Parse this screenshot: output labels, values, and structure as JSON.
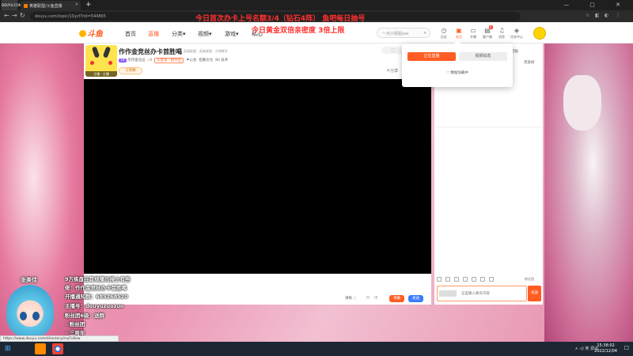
{
  "browser": {
    "corner_logo": "DOUYU.COM",
    "tab_title": "英雄联盟/斗鱼直播",
    "new_tab": "+",
    "url": "douyu.com/topic/10ycf?rid=544865",
    "window_controls": "— ▢ ✕"
  },
  "overlay_headlines": {
    "line1": "今日首次办卡上号名额3/4（钻石4阵）    鱼吧每日抽号",
    "line2": "今日黄金双倍亲密度  3倍上限"
  },
  "site_header": {
    "brand": "斗鱼",
    "nav": [
      "首页",
      "直播",
      "分类",
      "视频",
      "游戏",
      "私心"
    ],
    "search_placeholder": "一点小姐姐sex",
    "icons": [
      {
        "icon": "history-icon",
        "label": "历史"
      },
      {
        "icon": "follow-icon",
        "label": "关注"
      },
      {
        "icon": "broadcast-icon",
        "label": "开播"
      },
      {
        "icon": "client-icon",
        "label": "客户端"
      },
      {
        "icon": "bell-icon",
        "label": "消息"
      },
      {
        "icon": "task-icon",
        "label": "任务中心"
      }
    ],
    "client_badge": "6"
  },
  "room": {
    "anchor_level_bar": "主播 · 主播",
    "title": "作作金竞丝办卡首胜喝",
    "category": "英雄联盟 · 英雄联盟 · 大神教学",
    "tag": "14",
    "anchor_name": "作作金竞丝",
    "heat": "0",
    "rank": "斗鱼第一搞笑区",
    "fans_label": "公会",
    "region": "招募文化",
    "extra": "80 技术",
    "follow_chip": "订阅数",
    "share": "分享",
    "loading_glyph": "◌"
  },
  "player_bar": {
    "quality": "清晰",
    "settings": "◷",
    "full": "◫",
    "btn_orange": "弹幕",
    "btn_blue": "发送"
  },
  "right_panel": {
    "rank_top": "回报",
    "rank_sub": "贵族榜",
    "fan_club": "粉丝团",
    "chat_placeholder": "这里输入聊天内容",
    "send": "发送"
  },
  "follow_dropdown": {
    "tab_live": "正在直播",
    "tab_video": "视频动态",
    "loading": "数据加载中"
  },
  "stream_overlay": {
    "streamer_name": "张美佳",
    "lines": [
      "9方练盘在首规播出接上有些",
      "佬：作作金竞丝办卡首胜喝",
      "开播通知群：685268520",
      "主播号：douyuzuozuo",
      "粉丝团6级：送群",
      "☆粉丝团",
      "☆三周年"
    ]
  },
  "status_url": "https://www.douyu.com/directory/myFollow",
  "taskbar": {
    "start": "⊞",
    "tray": "∧  ◁) 英  源话",
    "time": "15:38:02",
    "date": "2022/12/04",
    "notif": "☐"
  }
}
